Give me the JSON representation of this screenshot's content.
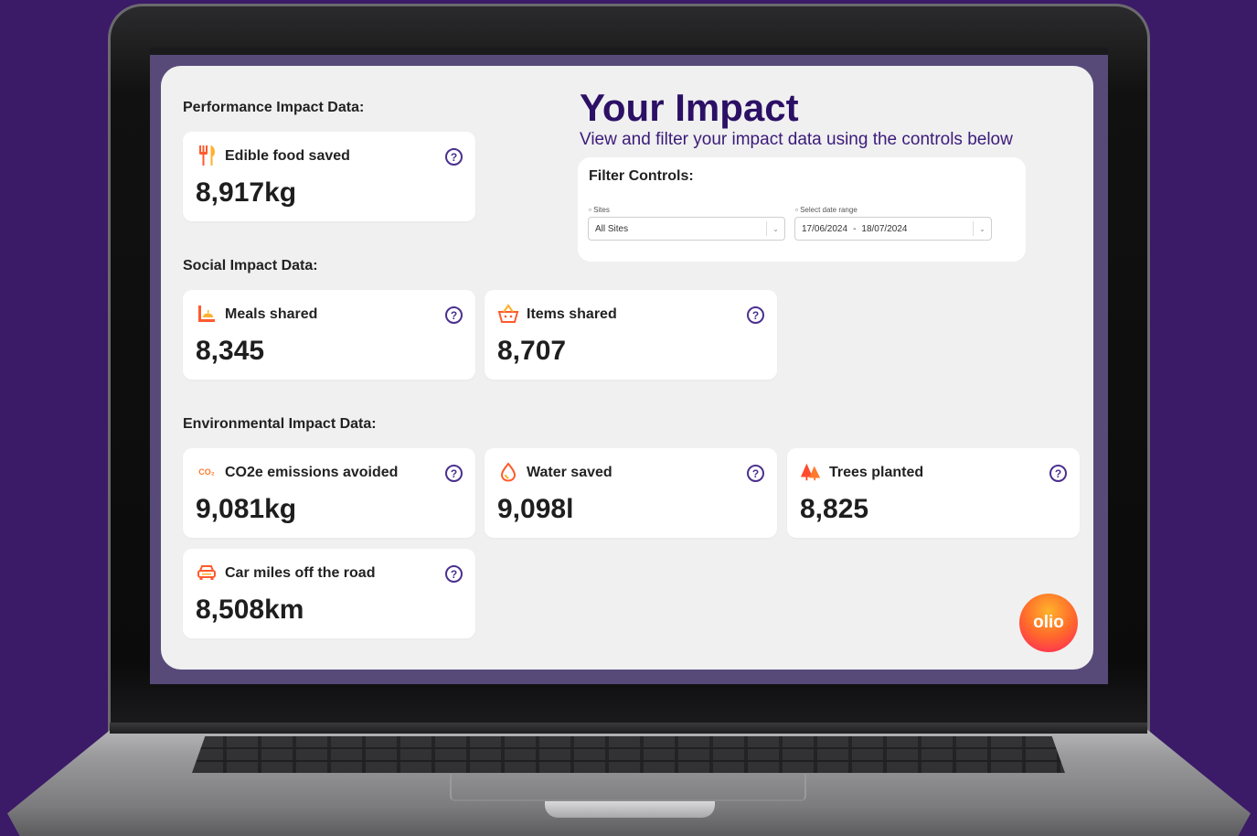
{
  "header": {
    "title": "Your Impact",
    "subtitle": "View and filter your impact data using the controls below"
  },
  "filters": {
    "title": "Filter Controls:",
    "sites": {
      "label": "Sites",
      "value": "All Sites"
    },
    "date_range": {
      "label": "Select date range",
      "start": "17/06/2024",
      "separator": "-",
      "end": "18/07/2024"
    }
  },
  "sections": {
    "performance": {
      "heading": "Performance Impact Data:",
      "cards": [
        {
          "icon": "cutlery-icon",
          "title": "Edible food saved",
          "value": "8,917kg"
        }
      ]
    },
    "social": {
      "heading": "Social Impact Data:",
      "cards": [
        {
          "icon": "meal-icon",
          "title": "Meals shared",
          "value": "8,345"
        },
        {
          "icon": "basket-icon",
          "title": "Items shared",
          "value": "8,707"
        }
      ]
    },
    "environmental": {
      "heading": "Environmental Impact Data:",
      "cards": [
        {
          "icon": "co2-icon",
          "title": "CO2e emissions avoided",
          "value": "9,081kg"
        },
        {
          "icon": "water-drop-icon",
          "title": "Water saved",
          "value": "9,098l"
        },
        {
          "icon": "trees-icon",
          "title": "Trees planted",
          "value": "8,825"
        },
        {
          "icon": "car-icon",
          "title": "Car miles off the road",
          "value": "8,508km"
        }
      ]
    }
  },
  "help_glyph": "?",
  "co2_glyph": "CO₂",
  "brand": {
    "logo_text": "olio"
  },
  "colors": {
    "background": "#3b1a67",
    "title": "#2b1065",
    "accent": "#ff6a2b",
    "help_icon": "#4b2f8f"
  }
}
